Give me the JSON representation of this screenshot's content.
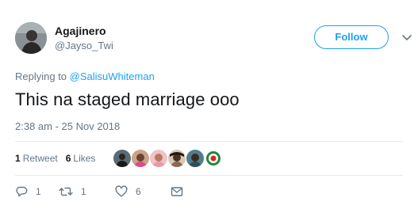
{
  "user": {
    "display_name": "Agajinero",
    "handle": "@Jayso_Twi"
  },
  "follow": {
    "label": "Follow"
  },
  "reply_context": {
    "prefix": "Replying to",
    "mention": "@SalisuWhiteman"
  },
  "tweet": {
    "text": "This na staged marriage ooo",
    "timestamp": "2:38 am - 25 Nov 2018"
  },
  "stats": {
    "retweets_count": "1",
    "retweets_label": "Retweet",
    "likes_count": "6",
    "likes_label": "Likes"
  },
  "liker_avatars": [
    "avatar-1",
    "avatar-2",
    "avatar-3",
    "avatar-4",
    "avatar-5",
    "avatar-6"
  ],
  "actions": {
    "reply_count": "1",
    "retweet_count": "1",
    "like_count": "6"
  },
  "colors": {
    "accent": "#1da1f2",
    "secondary_text": "#657786",
    "primary_text": "#14171a",
    "divider": "#e6ecf0"
  },
  "icons": {
    "reply": "reply-icon",
    "retweet": "retweet-icon",
    "like": "heart-icon",
    "message": "envelope-icon",
    "menu": "chevron-down-icon"
  }
}
